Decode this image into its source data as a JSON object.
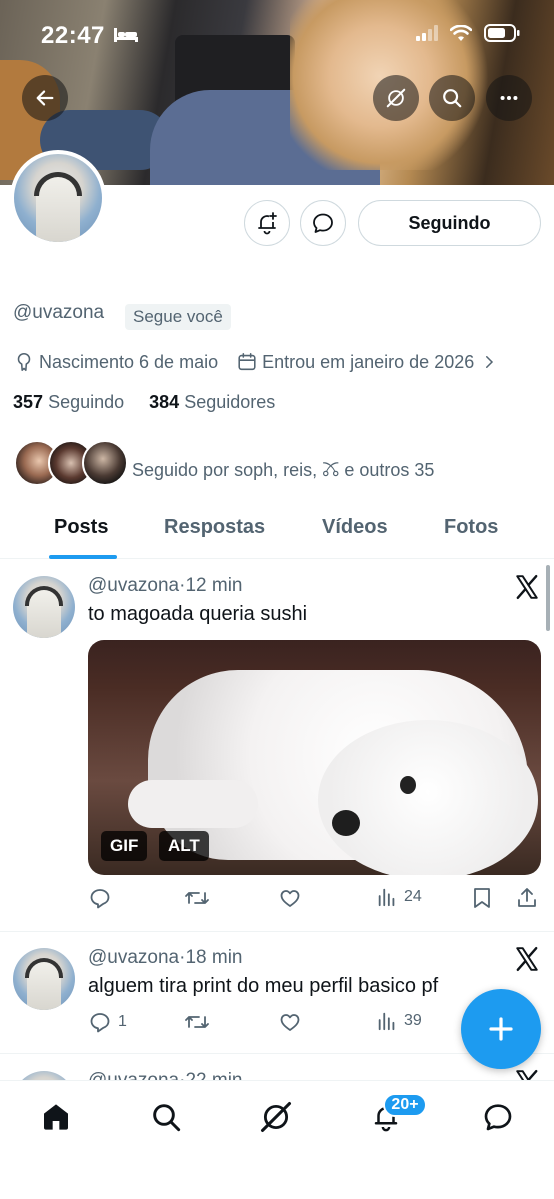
{
  "status_bar": {
    "time": "22:47"
  },
  "profile": {
    "handle": "@uvazona",
    "follows_you": "Segue você",
    "birth": "Nascimento 6 de maio",
    "joined": "Entrou em janeiro de 2026",
    "following_count": "357",
    "following_label": "Seguindo",
    "followers_count": "384",
    "followers_label": "Seguidores",
    "followed_by": "Seguido por soph, reis, 🜼 e outros 35",
    "following_button": "Seguindo"
  },
  "tabs": [
    "Posts",
    "Respostas",
    "Vídeos",
    "Fotos"
  ],
  "posts": [
    {
      "handle": "@uvazona",
      "time": "12 min",
      "text": "to magoada queria sushi",
      "media_badges": [
        "GIF",
        "ALT"
      ],
      "replies": "",
      "views": "24"
    },
    {
      "handle": "@uvazona",
      "time": "18 min",
      "text": "alguem tira print do meu perfil basico pf",
      "replies": "1",
      "views": "39"
    },
    {
      "handle": "@uvazona",
      "time": "22 min"
    }
  ],
  "bottom_nav": {
    "notifications_badge": "20+"
  },
  "colors": {
    "accent": "#1d9bf0",
    "text": "#0f1419",
    "muted": "#536471"
  },
  "icons": [
    "back-arrow-icon",
    "grok-icon",
    "search-icon",
    "more-icon",
    "bell-plus-icon",
    "message-icon",
    "pin-icon",
    "calendar-icon",
    "chevron-right-icon",
    "x-logo-icon",
    "reply-icon",
    "repost-icon",
    "like-icon",
    "views-icon",
    "bookmark-icon",
    "share-icon",
    "compose-plus-icon",
    "home-icon",
    "bell-icon"
  ]
}
